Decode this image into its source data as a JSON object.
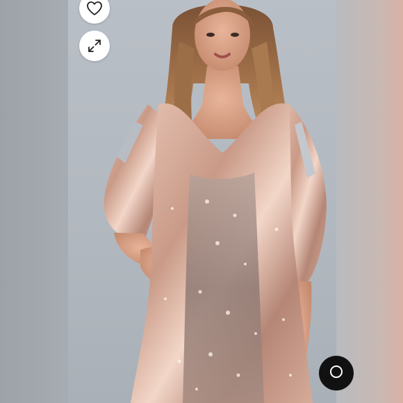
{
  "viewer": {
    "image_subject": "model-wearing-rose-gold-sequin-shift-dress",
    "buttons": [
      {
        "id": "like",
        "icon": "heart-outline-icon"
      },
      {
        "id": "expand",
        "icon": "expand-arrows-icon"
      }
    ],
    "bottom_control": {
      "icon": "round-control-icon"
    }
  },
  "colors": {
    "background": "#a9aeb4",
    "button_bg": "#ffffff",
    "icon": "#222222",
    "control_bg": "#111111",
    "dress_highlight": "#f2d6c8",
    "dress_mid": "#c99a87",
    "dress_shadow": "#8a6a62"
  }
}
